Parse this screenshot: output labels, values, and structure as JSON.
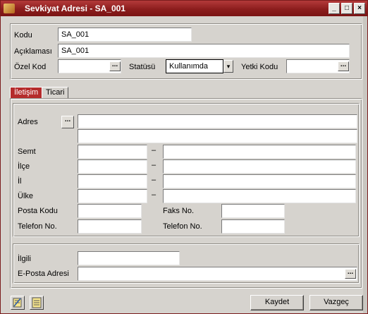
{
  "window": {
    "title": "Sevkiyat Adresi - SA_001",
    "min_glyph": "_",
    "max_glyph": "□",
    "close_glyph": "×"
  },
  "header": {
    "kodu_label": "Kodu",
    "kodu_value": "SA_001",
    "aciklama_label": "Açıklaması",
    "aciklama_value": "SA_001",
    "ozel_kod_label": "Özel Kod",
    "ozel_kod_value": "",
    "statusu_label": "Statüsü",
    "statusu_value": "Kullanımda",
    "yetki_kodu_label": "Yetki Kodu",
    "yetki_kodu_value": ""
  },
  "tabs": [
    {
      "label": "İletişim",
      "active": true
    },
    {
      "label": "Ticari",
      "active": false
    }
  ],
  "address": {
    "adres_label": "Adres",
    "adres_line1": "",
    "adres_line2": "",
    "semt_label": "Semt",
    "ilce_label": "İlçe",
    "il_label": "İl",
    "ulke_label": "Ülke",
    "dash": "–",
    "posta_kodu_label": "Posta Kodu",
    "faks_no_label": "Faks No.",
    "telefon_no_label": "Telefon No.",
    "telefon_no2_label": "Telefon No."
  },
  "contact": {
    "ilgili_label": "İlgili",
    "eposta_label": "E-Posta Adresi"
  },
  "footer": {
    "kaydet_label": "Kaydet",
    "vazgec_label": "Vazgeç"
  },
  "icons": {
    "browse": "...",
    "dropdown": "▾"
  },
  "colors": {
    "titlebar": "#8c1d1d",
    "active_tab": "#b52c2c",
    "form_bg": "#d6d3ce"
  }
}
